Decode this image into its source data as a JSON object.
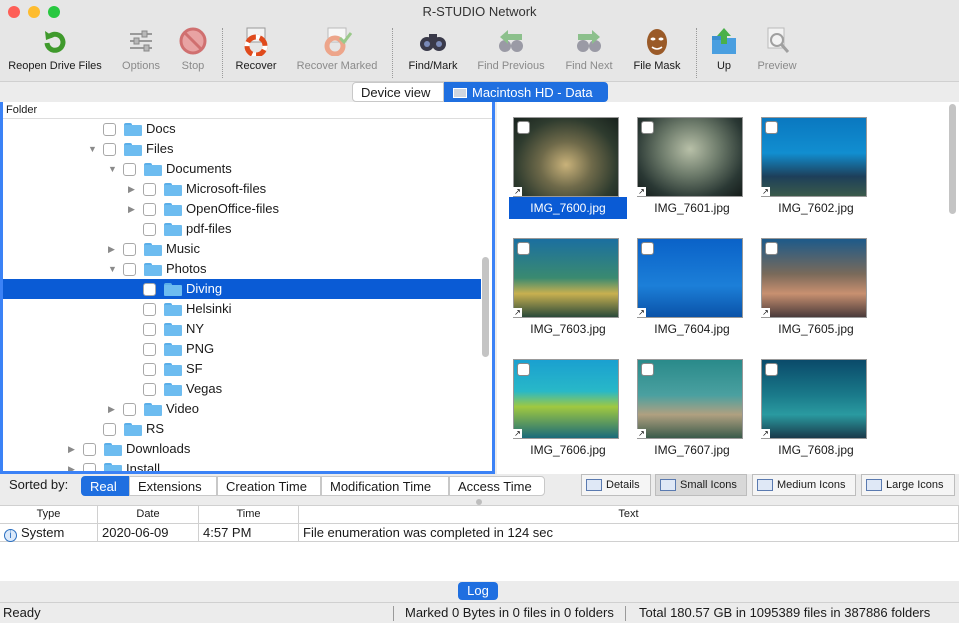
{
  "window": {
    "title": "R-STUDIO Network"
  },
  "toolbar": {
    "reopen": "Reopen Drive Files",
    "options": "Options",
    "stop": "Stop",
    "recover": "Recover",
    "recover_marked": "Recover Marked",
    "find_mark": "Find/Mark",
    "find_previous": "Find Previous",
    "find_next": "Find Next",
    "file_mask": "File Mask",
    "up": "Up",
    "preview": "Preview"
  },
  "view_tabs": {
    "device_view": "Device view",
    "current": "Macintosh HD - Data"
  },
  "tree": {
    "header": "Folder",
    "items": [
      {
        "label": "Docs"
      },
      {
        "label": "Files"
      },
      {
        "label": "Documents"
      },
      {
        "label": "Microsoft-files"
      },
      {
        "label": "OpenOffice-files"
      },
      {
        "label": "pdf-files"
      },
      {
        "label": "Music"
      },
      {
        "label": "Photos"
      },
      {
        "label": "Diving"
      },
      {
        "label": "Helsinki"
      },
      {
        "label": "NY"
      },
      {
        "label": "PNG"
      },
      {
        "label": "SF"
      },
      {
        "label": "Vegas"
      },
      {
        "label": "Video"
      },
      {
        "label": "RS"
      },
      {
        "label": "Downloads"
      },
      {
        "label": "Install"
      }
    ]
  },
  "files": [
    {
      "name": "IMG_7600.jpg"
    },
    {
      "name": "IMG_7601.jpg"
    },
    {
      "name": "IMG_7602.jpg"
    },
    {
      "name": "IMG_7603.jpg"
    },
    {
      "name": "IMG_7604.jpg"
    },
    {
      "name": "IMG_7605.jpg"
    },
    {
      "name": "IMG_7606.jpg"
    },
    {
      "name": "IMG_7607.jpg"
    },
    {
      "name": "IMG_7608.jpg"
    }
  ],
  "sort": {
    "label": "Sorted by:",
    "options": [
      "Real",
      "Extensions",
      "Creation Time",
      "Modification Time",
      "Access Time"
    ]
  },
  "view_modes": {
    "details": "Details",
    "small": "Small Icons",
    "medium": "Medium Icons",
    "large": "Large Icons"
  },
  "log": {
    "headers": [
      "Type",
      "Date",
      "Time",
      "Text"
    ],
    "rows": [
      {
        "type": "System",
        "date": "2020-06-09",
        "time": "4:57 PM",
        "text": "File enumeration was completed in 124 sec"
      }
    ],
    "tab": "Log"
  },
  "status": {
    "ready": "Ready",
    "marked": "Marked 0 Bytes in 0 files in 0 folders",
    "total": "Total 180.57 GB in 1095389 files in 387886 folders"
  }
}
